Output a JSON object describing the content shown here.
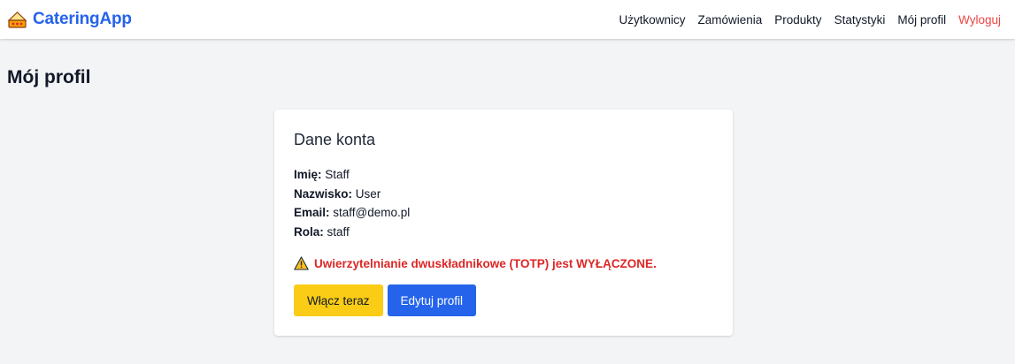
{
  "navbar": {
    "brand": "CateringApp",
    "brand_icon": "food-tray-icon",
    "links": [
      {
        "label": "Użytkownicy"
      },
      {
        "label": "Zamówienia"
      },
      {
        "label": "Produkty"
      },
      {
        "label": "Statystyki"
      },
      {
        "label": "Mój profil"
      },
      {
        "label": "Wyloguj"
      }
    ]
  },
  "page": {
    "title": "Mój profil"
  },
  "account_card": {
    "title": "Dane konta",
    "fields": [
      {
        "label": "Imię:",
        "value": "Staff"
      },
      {
        "label": "Nazwisko:",
        "value": "User"
      },
      {
        "label": "Email:",
        "value": "staff@demo.pl"
      },
      {
        "label": "Rola:",
        "value": "staff"
      }
    ],
    "warning_icon": "warning-triangle-icon",
    "warning_text": "Uwierzytelnianie dwuskładnikowe (TOTP) jest WYŁĄCZONE.",
    "enable_button": "Włącz teraz",
    "edit_button": "Edytuj profil"
  },
  "colors": {
    "brand": "#2563eb",
    "logout": "#ef4444",
    "warning": "#dc2626",
    "enable_button": "#facc15",
    "edit_button": "#2563eb",
    "background": "#f3f4f6"
  }
}
